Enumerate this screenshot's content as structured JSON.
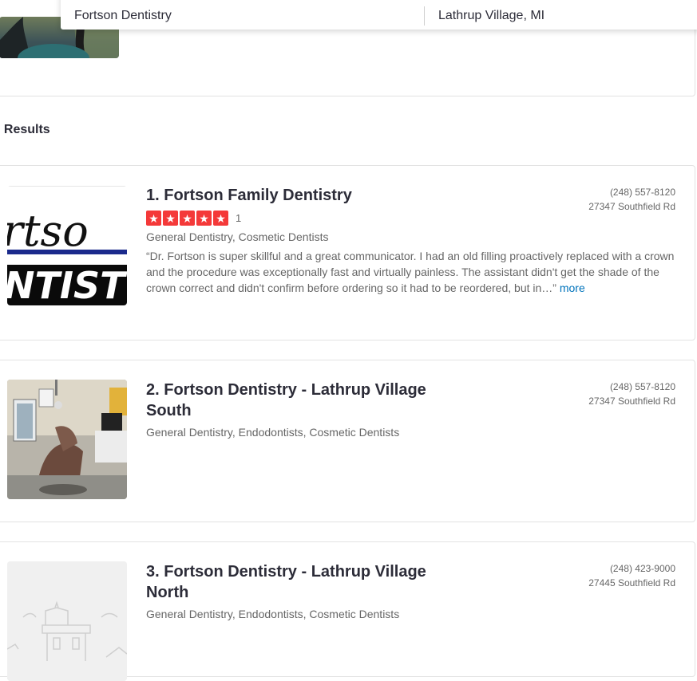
{
  "search": {
    "what": "Fortson Dentistry",
    "where": "Lathrup Village, MI"
  },
  "section_title": "l Results",
  "results": [
    {
      "name": "1. Fortson Family Dentistry",
      "rating_stars": 5,
      "review_count": "1",
      "categories": "General Dentistry, Cosmetic Dentists",
      "phone": "(248) 557-8120",
      "address": "27347 Southfield Rd",
      "snippet": "“Dr. Fortson is super skillful and a great communicator. I had an old filling proactively replaced with a crown and the procedure was exceptionally fast and virtually painless. The assistant didn't get the shade of the crown correct and didn't confirm before ordering so it had to be reordered, but in…”",
      "more_label": "more",
      "logo_text_top": "rtso",
      "logo_text_bottom": "NTIST"
    },
    {
      "name": "2. Fortson Dentistry - Lathrup Village South",
      "categories": "General Dentistry, Endodontists, Cosmetic Dentists",
      "phone": "(248) 557-8120",
      "address": "27347 Southfield Rd"
    },
    {
      "name": "3. Fortson Dentistry - Lathrup Village North",
      "categories": "General Dentistry, Endodontists, Cosmetic Dentists",
      "phone": "(248) 423-9000",
      "address": "27445 Southfield Rd"
    }
  ]
}
